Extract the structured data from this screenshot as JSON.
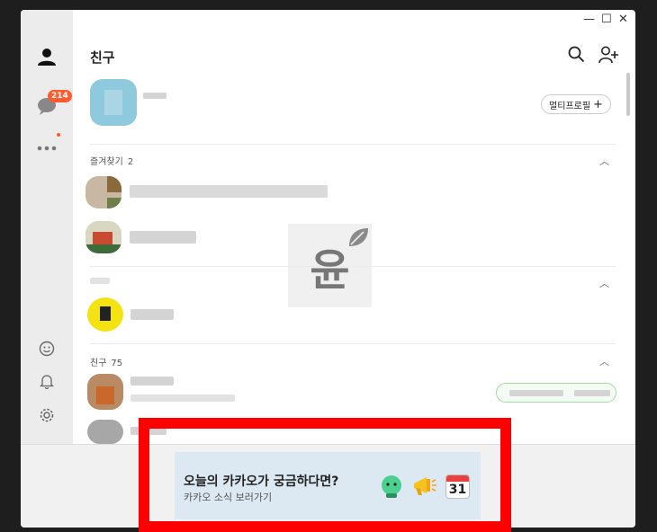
{
  "header": {
    "title": "친구"
  },
  "sidebar": {
    "chat_badge": "214"
  },
  "profile": {
    "multi_profile_label": "멀티프로필"
  },
  "sections": {
    "favorites": {
      "label": "즐겨찾기",
      "count": "2"
    },
    "friends": {
      "label": "친구",
      "count": "75"
    }
  },
  "watermark": {
    "text": "윤"
  },
  "banner": {
    "title": "오늘의 카카오가 궁금하다면?",
    "subtitle": "카카오 소식 보러가기",
    "calendar_day": "31"
  },
  "icons": [
    "person-icon",
    "chat-icon",
    "more-icon",
    "emoji-icon",
    "bell-icon",
    "gear-icon",
    "search-icon",
    "add-friend-icon",
    "plus-icon",
    "chevron-up-icon",
    "minimize-icon",
    "maximize-icon",
    "close-icon",
    "character-icon",
    "megaphone-icon",
    "calendar-icon",
    "leaf-icon"
  ],
  "colors": {
    "accent": "#ff5b2e",
    "highlight": "#ff0000",
    "banner_bg": "#dce8f2"
  }
}
